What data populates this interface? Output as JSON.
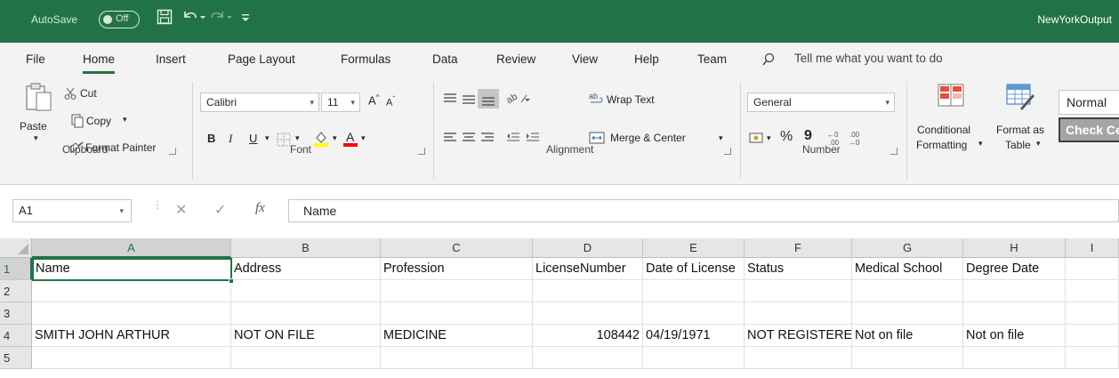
{
  "titlebar": {
    "autosave_label": "AutoSave",
    "autosave_state": "Off",
    "document_title": "NewYorkOutput",
    "accent_color": "#217346"
  },
  "menu": {
    "tabs": [
      "File",
      "Home",
      "Insert",
      "Page Layout",
      "Formulas",
      "Data",
      "Review",
      "View",
      "Help",
      "Team"
    ],
    "active_tab": "Home",
    "tell_me": "Tell me what you want to do"
  },
  "ribbon": {
    "clipboard": {
      "paste": "Paste",
      "cut": "Cut",
      "copy": "Copy",
      "format_painter": "Format Painter",
      "label": "Clipboard"
    },
    "font": {
      "family": "Calibri",
      "size": "11",
      "bold": "B",
      "italic": "I",
      "underline": "U",
      "label": "Font"
    },
    "alignment": {
      "wrap_text": "Wrap Text",
      "merge_center": "Merge & Center",
      "label": "Alignment"
    },
    "number": {
      "format": "General",
      "percent": "%",
      "comma": "9",
      "label": "Number"
    },
    "styles": {
      "conditional_1": "Conditional",
      "conditional_2": "Formatting",
      "format_as_1": "Format as",
      "format_as_2": "Table",
      "normal": "Normal",
      "check_cell": "Check Cell"
    }
  },
  "formula_bar": {
    "name_box": "A1",
    "fx": "fx",
    "value": "Name"
  },
  "sheet": {
    "columns": [
      "A",
      "B",
      "C",
      "D",
      "E",
      "F",
      "G",
      "H",
      "I"
    ],
    "rows": [
      "1",
      "2",
      "3",
      "4",
      "5"
    ],
    "row1": [
      "Name",
      "Address",
      "Profession",
      "LicenseNumber",
      "Date of License",
      "Status",
      "Medical School",
      "Degree Date",
      ""
    ],
    "row4": [
      "SMITH JOHN ARTHUR",
      "NOT ON FILE",
      "MEDICINE",
      "108442",
      "04/19/1971",
      "NOT REGISTERED",
      "Not on file",
      "Not on file",
      ""
    ]
  }
}
